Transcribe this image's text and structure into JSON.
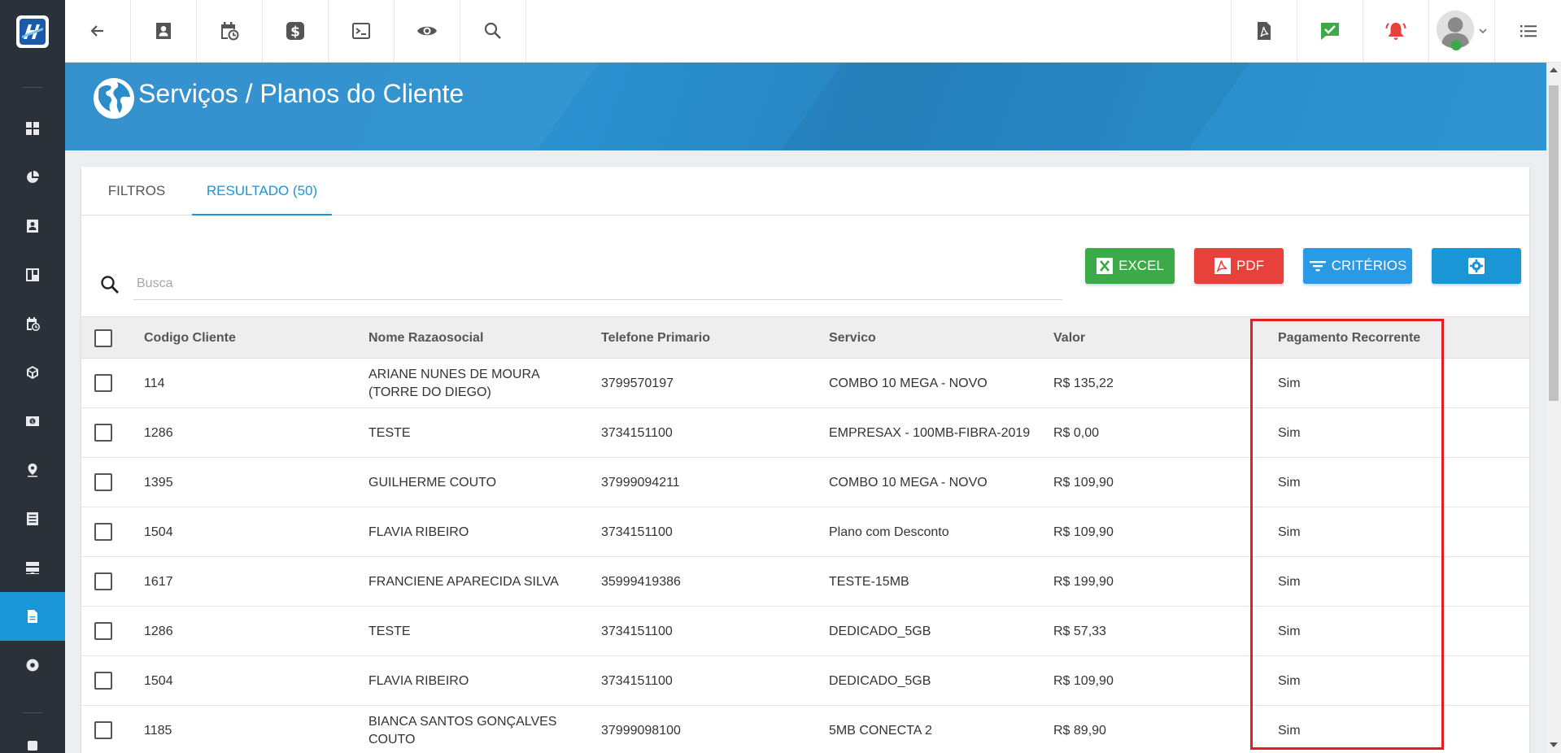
{
  "page": {
    "title": "Serviços / Planos do Cliente"
  },
  "tabs": [
    {
      "label": "FILTROS"
    },
    {
      "label": "RESULTADO (50)"
    }
  ],
  "search": {
    "placeholder": "Busca",
    "value": ""
  },
  "actions": {
    "excel": "EXCEL",
    "pdf": "PDF",
    "criteria": "CRITÉRIOS"
  },
  "table": {
    "columns": [
      "Codigo Cliente",
      "Nome Razaosocial",
      "Telefone Primario",
      "Servico",
      "Valor",
      "Pagamento Recorrente"
    ],
    "rows": [
      [
        "114",
        "ARIANE NUNES DE MOURA (TORRE DO DIEGO)",
        "3799570197",
        "COMBO 10 MEGA - NOVO",
        "R$ 135,22",
        "Sim"
      ],
      [
        "1286",
        "TESTE",
        "3734151100",
        "EMPRESAX - 100MB-FIBRA-2019",
        "R$ 0,00",
        "Sim"
      ],
      [
        "1395",
        "GUILHERME COUTO",
        "37999094211",
        "COMBO 10 MEGA - NOVO",
        "R$ 109,90",
        "Sim"
      ],
      [
        "1504",
        "FLAVIA RIBEIRO",
        "3734151100",
        "Plano com Desconto",
        "R$ 109,90",
        "Sim"
      ],
      [
        "1617",
        "FRANCIENE APARECIDA SILVA",
        "35999419386",
        "TESTE-15MB",
        "R$ 199,90",
        "Sim"
      ],
      [
        "1286",
        "TESTE",
        "3734151100",
        "DEDICADO_5GB",
        "R$ 57,33",
        "Sim"
      ],
      [
        "1504",
        "FLAVIA RIBEIRO",
        "3734151100",
        "DEDICADO_5GB",
        "R$ 109,90",
        "Sim"
      ],
      [
        "1185",
        "BIANCA SANTOS GONÇALVES COUTO",
        "37999098100",
        "5MB CONECTA 2",
        "R$ 89,90",
        "Sim"
      ]
    ]
  },
  "colors": {
    "accent": "#1a95d6",
    "sidebar": "#2b3138",
    "excel": "#3daa4a",
    "pdf": "#e8403a",
    "criteria": "#2b9ae4",
    "highlight": "#e41e1e"
  },
  "icons": {
    "sidebar": [
      "dashboard-icon",
      "pie-chart-icon",
      "contact-card-icon",
      "kanban-icon",
      "calendar-clock-icon",
      "package-icon",
      "money-icon",
      "map-pin-icon",
      "list-doc-icon",
      "server-icon",
      "document-icon",
      "gear-icon"
    ],
    "topbar": [
      "back-arrow-icon",
      "contact-card-icon",
      "calendar-clock-icon",
      "dollar-icon",
      "terminal-icon",
      "eye-icon",
      "search-icon",
      "pdf-file-icon",
      "check-chat-icon",
      "alarm-icon",
      "user-avatar-icon",
      "list-menu-icon"
    ]
  }
}
